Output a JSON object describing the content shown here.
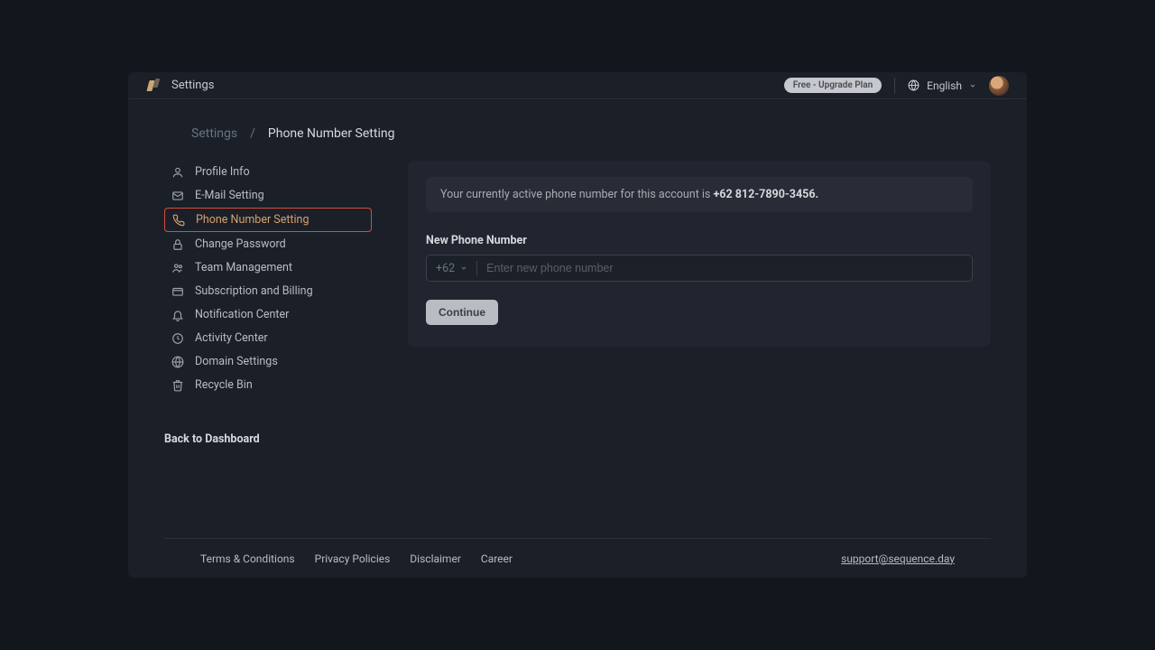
{
  "header": {
    "title": "Settings",
    "upgrade_label": "Free - Upgrade Plan",
    "language": "English"
  },
  "breadcrumb": {
    "root": "Settings",
    "sep": "/",
    "current": "Phone Number Setting"
  },
  "sidebar": {
    "items": [
      {
        "label": "Profile Info"
      },
      {
        "label": "E-Mail Setting"
      },
      {
        "label": "Phone Number Setting"
      },
      {
        "label": "Change Password"
      },
      {
        "label": "Team Management"
      },
      {
        "label": "Subscription and Billing"
      },
      {
        "label": "Notification Center"
      },
      {
        "label": "Activity Center"
      },
      {
        "label": "Domain Settings"
      },
      {
        "label": "Recycle Bin"
      }
    ],
    "back_label": "Back to Dashboard"
  },
  "main": {
    "info_prefix": "Your currently active phone number for this account is ",
    "active_phone": "+62 812-7890-3456.",
    "field_label": "New Phone Number",
    "country_code": "+62",
    "placeholder": "Enter new phone number",
    "continue_label": "Continue"
  },
  "footer": {
    "links": [
      "Terms & Conditions",
      "Privacy Policies",
      "Disclaimer",
      "Career"
    ],
    "support": "support@sequence.day"
  }
}
